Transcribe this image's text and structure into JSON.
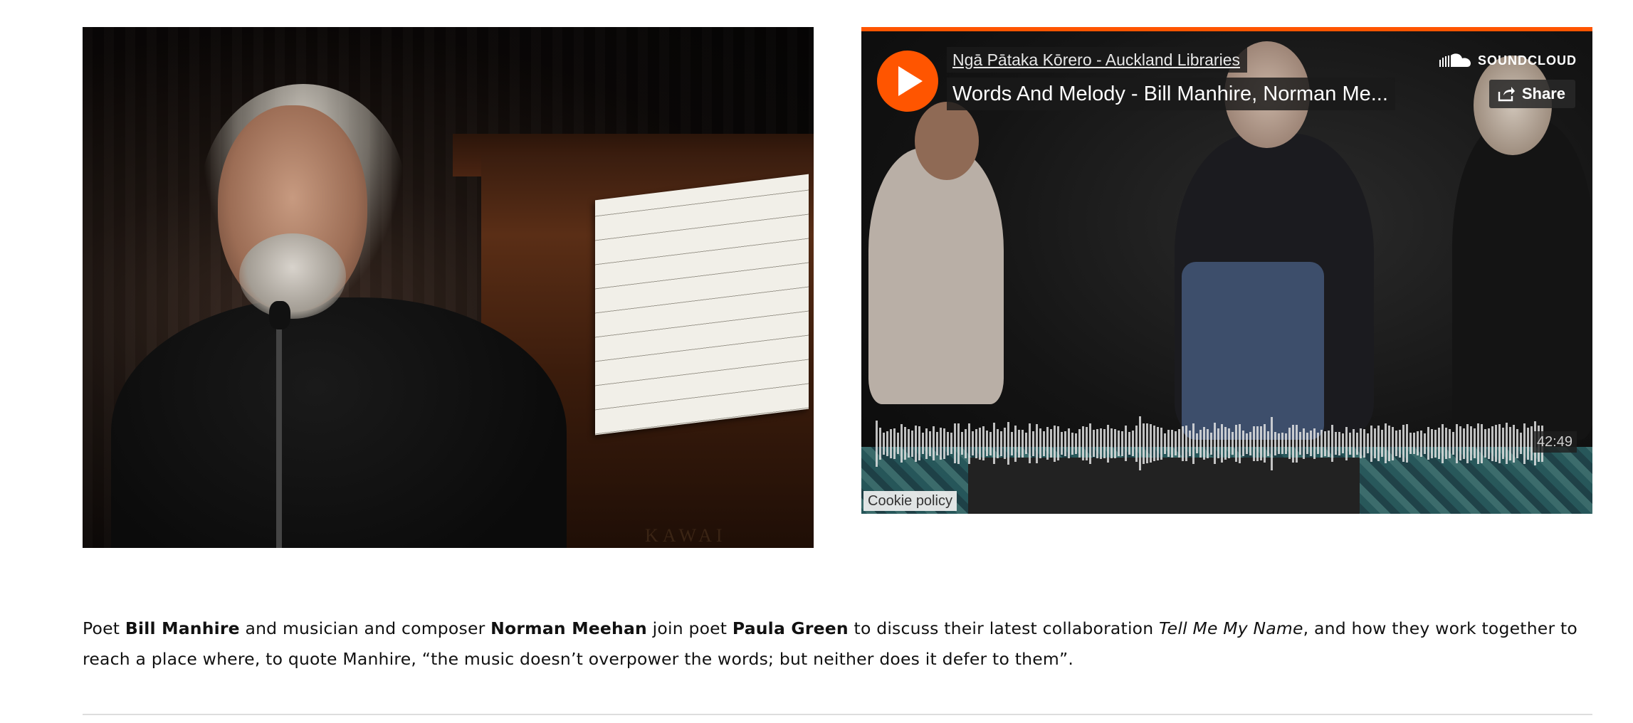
{
  "photo": {
    "alt": "Musician speaking at microphone beside piano",
    "piano_brand": "KAWAI"
  },
  "player": {
    "artist": "Ngā Pātaka Kōrero - Auckland Libraries",
    "track_title": "Words And Melody - Bill Manhire, Norman Me...",
    "logo_text": "SOUNDCLOUD",
    "share_label": "Share",
    "duration": "42:49",
    "cookie_label": "Cookie policy",
    "accent_color": "#ff5500",
    "icons": [
      "play-icon",
      "soundcloud-cloud-icon",
      "share-icon"
    ]
  },
  "caption": {
    "t1": "Poet ",
    "b1": "Bill Manhire",
    "t2": " and musician and composer ",
    "b2": "Norman Meehan",
    "t3": " join poet ",
    "b3": "Paula Green",
    "t4": " to discuss their latest collaboration ",
    "i1": "Tell Me My Name",
    "t5": ", and how they work together to reach a place where, to quote Manhire, “the music doesn’t overpower the words; but neither does it defer to them”."
  }
}
